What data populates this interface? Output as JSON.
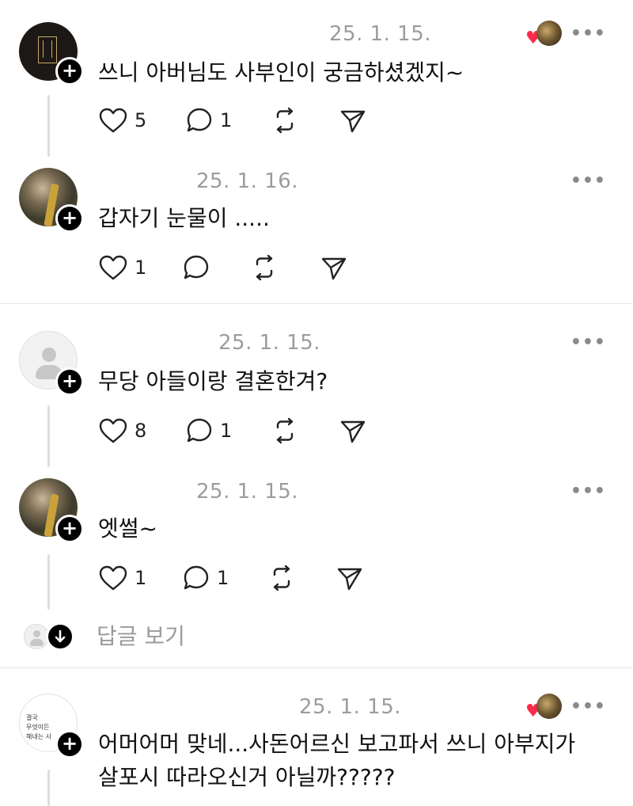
{
  "comments": [
    {
      "date": "25. 1. 15.",
      "text": "쓰니 아버님도 사부인이 궁금하셨겠지~",
      "likes": "5",
      "replies": "1",
      "liked_by_author": true
    },
    {
      "date": "25. 1. 16.",
      "text": "갑자기 눈물이 .....",
      "likes": "1",
      "replies": ""
    },
    {
      "date": "25. 1. 15.",
      "text": "무당 아들이랑 결혼한겨?",
      "likes": "8",
      "replies": "1"
    },
    {
      "date": "25. 1. 15.",
      "text": "엣썰~",
      "likes": "1",
      "replies": "1"
    },
    {
      "date": "25. 1. 15.",
      "text_line1": "어머어머 맞네...사돈어르신 보고파서 쓰니 아부지가",
      "text_line2": "살포시 따라오신거 아닐까?????",
      "liked_by_author": true,
      "avatar_text": [
        "결국",
        "무엇이든",
        "해내는 사"
      ]
    }
  ],
  "view_replies_label": "답글 보기",
  "more_label": "•••",
  "colors": {
    "heart": "#ff2b4d",
    "muted": "#9c9c9c"
  }
}
